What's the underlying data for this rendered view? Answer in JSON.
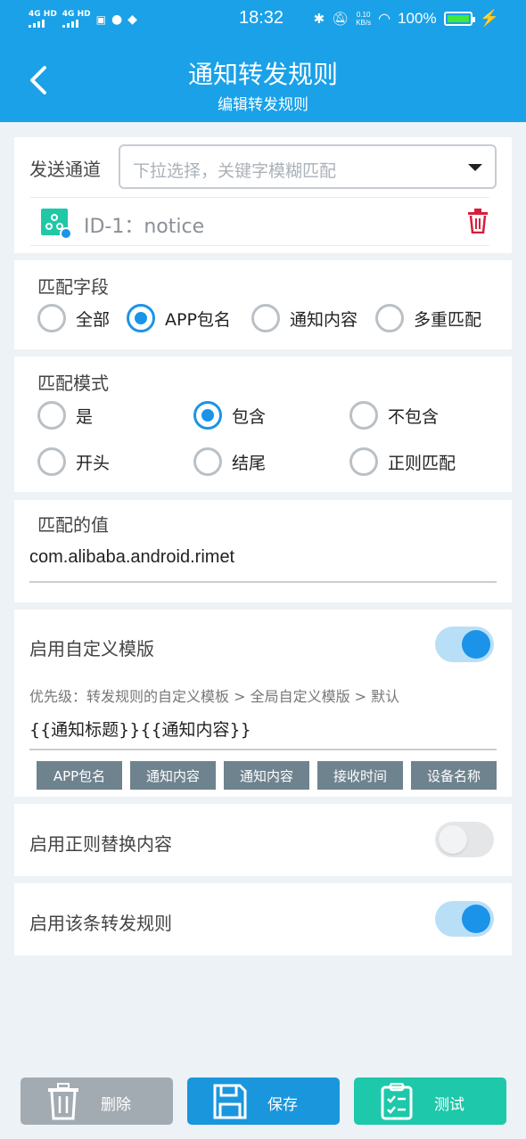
{
  "status_bar": {
    "net1": "4G HD",
    "net2": "4G HD",
    "time": "18:32",
    "speed_top": "0.10",
    "speed_unit": "KB/s",
    "battery": "100%"
  },
  "header": {
    "title": "通知转发规则",
    "subtitle": "编辑转发规则"
  },
  "channel": {
    "label": "发送通道",
    "placeholder": "下拉选择，关键字模糊匹配",
    "selected": "ID-1：notice"
  },
  "match_field": {
    "label": "匹配字段",
    "options": [
      "全部",
      "APP包名",
      "通知内容",
      "多重匹配"
    ],
    "selected": "APP包名"
  },
  "match_mode": {
    "label": "匹配模式",
    "options": [
      "是",
      "包含",
      "不包含",
      "开头",
      "结尾",
      "正则匹配"
    ],
    "selected": "包含"
  },
  "match_value": {
    "label": "匹配的值",
    "value": "com.alibaba.android.rimet"
  },
  "custom_template": {
    "label": "启用自定义模版",
    "enabled": true,
    "hint": "优先级：转发规则的自定义模板 > 全局自定义模版 > 默认",
    "template": "{{通知标题}}{{通知内容}}",
    "chips": [
      "APP包名",
      "通知内容",
      "通知内容",
      "接收时间",
      "设备名称"
    ]
  },
  "regex_replace": {
    "label": "启用正则替换内容",
    "enabled": false
  },
  "rule_enabled": {
    "label": "启用该条转发规则",
    "enabled": true
  },
  "buttons": {
    "delete": "删除",
    "save": "保存",
    "test": "测试"
  },
  "colors": {
    "primary": "#1aa1e8",
    "accent": "#1b93e9",
    "delete_btn": "#a3abb2",
    "save_btn": "#1a96dd",
    "test_btn": "#1ec8aa",
    "danger": "#d61e3c"
  }
}
